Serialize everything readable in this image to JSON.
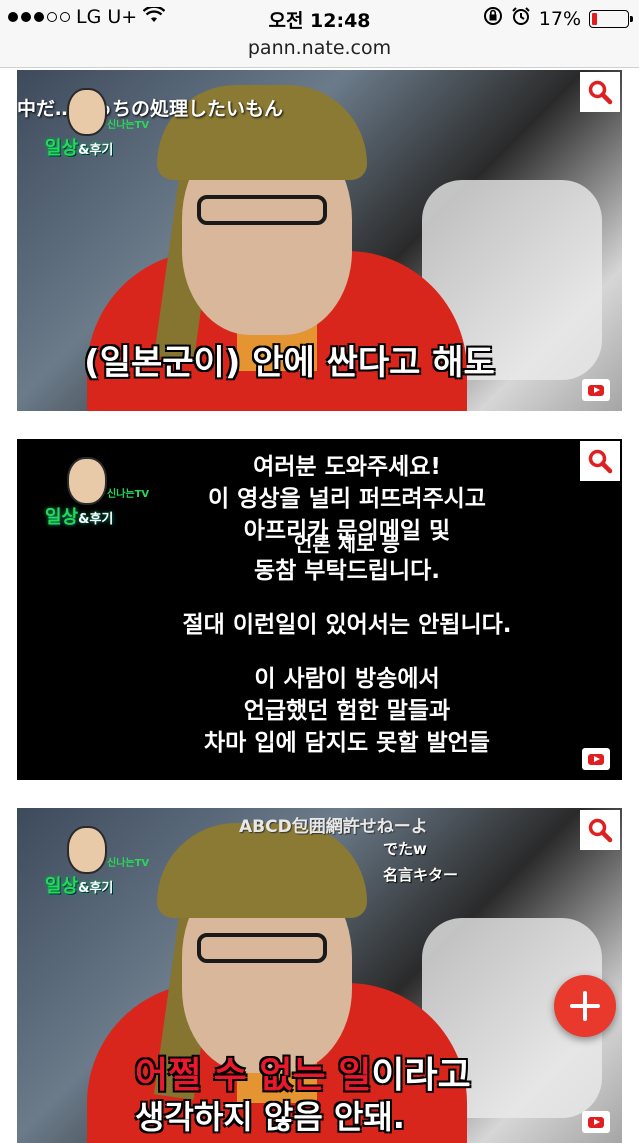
{
  "status_bar": {
    "carrier": "LG U+",
    "time": "오전 12:48",
    "battery": "17%",
    "signal_icon": "signal-dots-icon",
    "wifi_icon": "wifi-icon"
  },
  "browser": {
    "url": "pann.nate.com"
  },
  "logo": {
    "main": "일상",
    "suffix": "&후기",
    "tag": "신나는TV"
  },
  "videos": [
    {
      "overlay_text": "中だ…あっちの処理したいもん",
      "caption": "(일본군이) 안에 싼다고 해도"
    },
    {
      "lines": [
        "여러분 도와주세요!",
        "이 영상을 널리 퍼뜨려주시고",
        "아프리카 문의메일 및",
        "언론 제보 등",
        "동참 부탁드립니다.",
        "절대 이런일이 있어서는 안됩니다.",
        "이 사람이 방송에서",
        "언급했던 험한 말들과",
        "차마 입에 담지도 못할 발언들"
      ]
    },
    {
      "overlay_jp_1": "ABCD包囲網許せねーよ",
      "overlay_jp_2": "でたw",
      "overlay_jp_3": "名言キター",
      "caption_red": "어쩔 수 없는 일",
      "caption_rest": "이라고",
      "caption_line2": "생각하지 않음 안돼."
    }
  ],
  "colors": {
    "accent_red": "#e8392c",
    "logo_green": "#28d85a"
  }
}
